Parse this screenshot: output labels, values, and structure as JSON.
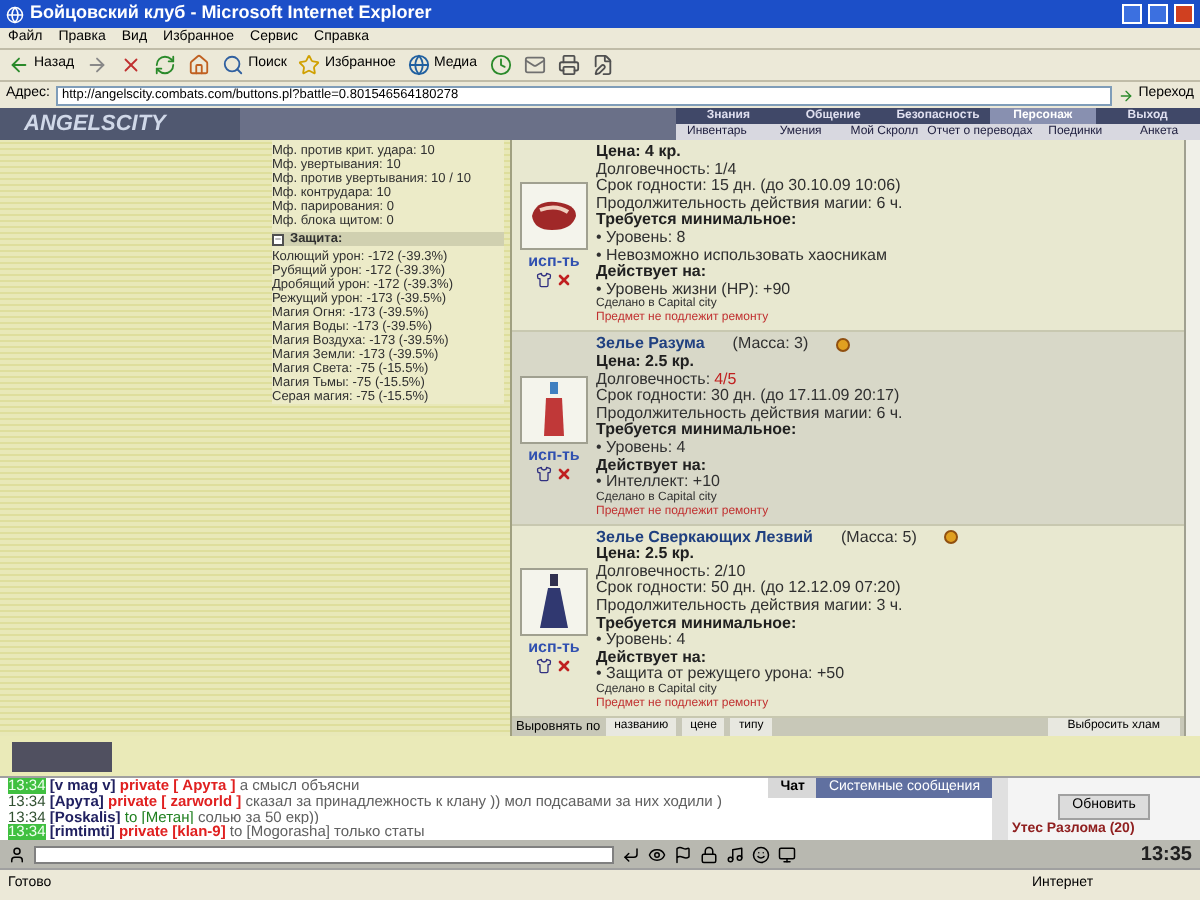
{
  "window": {
    "title": "Бойцовский клуб - Microsoft Internet Explorer"
  },
  "menu": [
    "Файл",
    "Правка",
    "Вид",
    "Избранное",
    "Сервис",
    "Справка"
  ],
  "toolbar": [
    {
      "kind": "back",
      "label": "Назад"
    },
    {
      "kind": "forward"
    },
    {
      "kind": "stop"
    },
    {
      "kind": "refresh"
    },
    {
      "kind": "home"
    },
    {
      "kind": "search",
      "label": "Поиск"
    },
    {
      "kind": "favorites",
      "label": "Избранное"
    },
    {
      "kind": "media",
      "label": "Медиа"
    },
    {
      "kind": "history"
    },
    {
      "kind": "mail"
    },
    {
      "kind": "print"
    },
    {
      "kind": "edit"
    }
  ],
  "address": {
    "label": "Адрес:",
    "url": "http://angelscity.combats.com/buttons.pl?battle=0.801546564180278",
    "go": "Переход"
  },
  "game": {
    "logo": "ANGELSCITY",
    "nav": [
      {
        "label": "Знания",
        "selected": false
      },
      {
        "label": "Общение",
        "selected": false
      },
      {
        "label": "Безопасность",
        "selected": false
      },
      {
        "label": "Персонаж",
        "selected": true
      },
      {
        "label": "Выход",
        "selected": false
      }
    ],
    "subnav": [
      "Инвентарь",
      "Умения",
      "Мой Скролл",
      "Отчет о переводах",
      "Поединки",
      "Анкета"
    ]
  },
  "stats": {
    "lines": [
      "Мф. против крит. удара: 10",
      "Мф. увертывания: 10",
      "Мф. против увертывания: 10 / 10",
      "Мф. контрудара: 10",
      "Мф. парирования: 0",
      "Мф. блока щитом: 0"
    ],
    "section": {
      "title": "Защита:",
      "expanded": true
    },
    "protection": [
      "Колющий урон: -172 (-39.3%)",
      "Рубящий урон: -172 (-39.3%)",
      "Дробящий урон: -172 (-39.3%)",
      "Режущий урон: -173 (-39.5%)",
      "Магия Огня: -173 (-39.5%)",
      "Магия Воды: -173 (-39.5%)",
      "Магия Воздуха: -173 (-39.5%)",
      "Магия Земли: -173 (-39.5%)",
      "Магия Света: -75 (-15.5%)",
      "Магия Тьмы: -75 (-15.5%)",
      "Серая магия: -75 (-15.5%)"
    ]
  },
  "items": [
    {
      "kind": "meat",
      "highlighted": false,
      "use": "исп-ть",
      "price": "Цена: 4 кр.",
      "durability_label": "Долговечность: ",
      "durability": "1/4",
      "worn": false,
      "expiry": "Срок годности: 15 дн. (до 30.10.09 10:06)",
      "magic": "Продолжительность действия магии: 6 ч.",
      "req_title": "Требуется минимальное:",
      "requirements": [
        "• Уровень: 8",
        "• Невозможно использовать хаосникам"
      ],
      "effects_title": "Действует на:",
      "effects": [
        "• Уровень жизни (HP): +90"
      ],
      "made": "Сделано в Capital city",
      "repair": "Предмет не подлежит ремонту"
    },
    {
      "kind": "potion-red",
      "highlighted": true,
      "name": "Зелье Разума",
      "mass": "(Масса: 3)",
      "use": "исп-ть",
      "price": "Цена: 2.5 кр.",
      "durability_label": "Долговечность: ",
      "durability": "4/5",
      "worn": true,
      "expiry": "Срок годности: 30 дн. (до 17.11.09 20:17)",
      "magic": "Продолжительность действия магии: 6 ч.",
      "req_title": "Требуется минимальное:",
      "requirements": [
        "• Уровень: 4"
      ],
      "effects_title": "Действует на:",
      "effects": [
        "• Интеллект: +10"
      ],
      "made": "Сделано в Capital city",
      "repair": "Предмет не подлежит ремонту"
    },
    {
      "kind": "potion-blue",
      "highlighted": false,
      "name": "Зелье Сверкающих Лезвий",
      "mass": "(Масса: 5)",
      "use": "исп-ть",
      "price": "Цена: 2.5 кр.",
      "durability_label": "Долговечность: ",
      "durability": "2/10",
      "worn": false,
      "expiry": "Срок годности: 50 дн. (до 12.12.09 07:20)",
      "magic": "Продолжительность действия магии: 3 ч.",
      "req_title": "Требуется минимальное:",
      "requirements": [
        "• Уровень: 4"
      ],
      "effects_title": "Действует на:",
      "effects": [
        "• Защита от режущего урона: +50"
      ],
      "made": "Сделано в Capital city",
      "repair": "Предмет не подлежит ремонту"
    }
  ],
  "sort": {
    "label": "Выровнять по",
    "buttons": [
      "названию",
      "цене",
      "типу"
    ],
    "discard": "Выбросить хлам"
  },
  "chat": {
    "tabs": [
      {
        "label": "Чат",
        "selected": true
      },
      {
        "label": "Системные сообщения",
        "selected": false
      }
    ],
    "lines": [
      {
        "time": "13:34",
        "highlight": true,
        "name": "[v mag v]",
        "kind": "private",
        "target": "private [ Арута ]",
        "text": "а смысл объясни"
      },
      {
        "time": "13:34",
        "highlight": false,
        "name": "[Арута]",
        "kind": "private",
        "target": "private [ zarworld ]",
        "text": "сказал за принадлежность к клану )) мол подсавами за них ходили )"
      },
      {
        "time": "13:34",
        "highlight": false,
        "name": "[Poskalis]",
        "kind": "to",
        "target": "to [Метан]",
        "text": "солью за 50 екр))"
      },
      {
        "time": "13:34",
        "highlight": true,
        "name": "[rimtimti]",
        "kind": "private",
        "target": "private [klan-9]",
        "text": "to [Mogorasha] только статы"
      }
    ],
    "refresh": "Обновить",
    "location": "Утес Разлома (20)",
    "clock": "13:35"
  },
  "status": {
    "text": "Готово",
    "zone": "Интернет"
  }
}
